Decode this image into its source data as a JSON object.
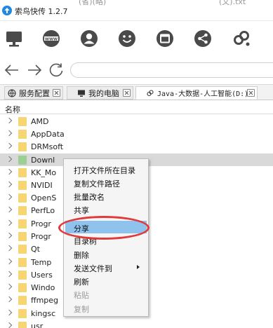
{
  "window": {
    "title": "索鸟快传 1.2.7"
  },
  "title_bleed": [
    "(省)(略)",
    "(文).txt"
  ],
  "toolbar": {
    "icons": [
      "monitor-icon",
      "web-icon",
      "user-icon",
      "smile-icon",
      "window-icon",
      "share-icon",
      "link-icon"
    ]
  },
  "nav": {
    "back": "back-arrow-icon",
    "forward": "forward-arrow-icon",
    "refresh": "refresh-icon",
    "address_value": ""
  },
  "tabs": [
    {
      "label": "服务配置",
      "icon": "globe-icon"
    },
    {
      "label": "我的电脑",
      "icon": "monitor-icon"
    },
    {
      "label": "Java-大数据-人工智能(D:)",
      "icon": "link-icon"
    }
  ],
  "column": {
    "name_header": "名称"
  },
  "files": [
    "AMD",
    "AppData",
    "DRMsoft",
    "Downl",
    "KK_Mo",
    "NVIDI",
    "OpenS",
    "PerfLo",
    "Progr",
    "Progr",
    "Qt",
    "Temp",
    "Users",
    "Windo",
    "ffmpeg",
    "kingsc",
    "usr"
  ],
  "context_menu": {
    "items": [
      {
        "label": "打开文件所在目录",
        "enabled": true
      },
      {
        "label": "复制文件路径",
        "enabled": true
      },
      {
        "label": "批量改名",
        "enabled": true
      },
      {
        "label": "共享",
        "enabled": true
      },
      {
        "label": "分享",
        "enabled": true,
        "highlighted": true
      },
      {
        "label": "目录树",
        "enabled": true
      },
      {
        "label": "删除",
        "enabled": true
      },
      {
        "label": "发送文件到",
        "enabled": true,
        "submenu": true
      },
      {
        "label": "刷新",
        "enabled": true
      },
      {
        "label": "粘贴",
        "enabled": false
      },
      {
        "label": "复制",
        "enabled": false
      }
    ]
  },
  "colors": {
    "accent": "#1e88e5",
    "folder": "#f6d572",
    "menu_highlight": "#8fc3ee",
    "annotation": "#e03a3a",
    "icon_fill": "#4a4a4a"
  }
}
